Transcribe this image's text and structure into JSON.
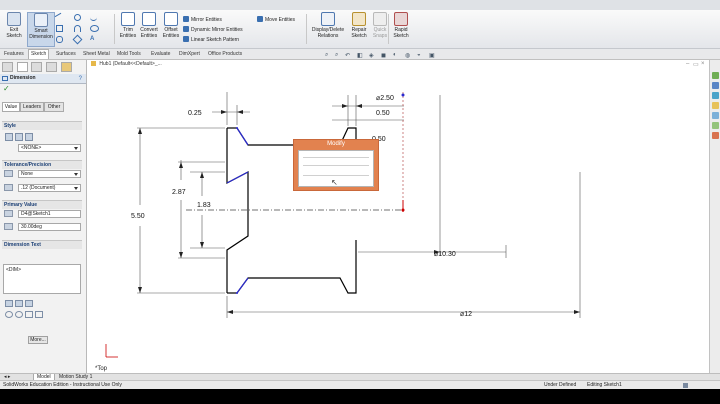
{
  "ribbon": {
    "exit_sketch": "Exit Sketch",
    "smart_dimension": "Smart Dimension",
    "trim_entities": "Trim Entities",
    "convert_entities": "Convert Entities",
    "offset_entities": "Offset Entities",
    "mirror_entities": "Mirror Entities",
    "dynamic_mirror_entities": "Dynamic Mirror Entities",
    "linear_sketch_pattern": "Linear Sketch Pattern",
    "move_entities": "Move Entities",
    "display_delete_relations": "Display/Delete Relations",
    "repair_sketch": "Repair Sketch",
    "quick_snaps": "Quick Snaps",
    "rapid_sketch": "Rapid Sketch"
  },
  "command_tabs": [
    "Features",
    "Sketch",
    "Surfaces",
    "Sheet Metal",
    "Mold Tools",
    "Evaluate",
    "DimXpert",
    "Office Products"
  ],
  "active_command_tab": "Sketch",
  "feature_tree": {
    "breadcrumb": "Hub1 (Default<<Default>_..."
  },
  "property_manager": {
    "title": "Dimension",
    "subtabs": [
      "Value",
      "Leaders",
      "Other"
    ],
    "style_label": "Style",
    "style_value": "<NONE>",
    "tolerance_label": "Tolerance/Precision",
    "tolerance_value": "None",
    "precision_value": ".12 (Document)",
    "primary_value_label": "Primary Value",
    "primary_value_name": "D4@Sketch1",
    "primary_value_value": "30.00deg",
    "dimension_text_label": "Dimension Text",
    "dimension_text_value": "<DIM>",
    "more_button": "More..."
  },
  "drawing": {
    "dims": {
      "d025": "0.25",
      "d250": "⌀2.50",
      "d050a": "0.50",
      "d050b": "0.50",
      "d287": "2.87",
      "d183": "1.83",
      "d550": "5.50",
      "d1030": "⌀10.30",
      "d12": "⌀12"
    },
    "view_label": "*Top"
  },
  "modify_dialog": {
    "title": "Modify"
  },
  "model_tabs": [
    "Model",
    "Motion Study 1"
  ],
  "status_bar": {
    "left": "SolidWorks Education Edition - Instructional Use Only",
    "state": "Under Defined",
    "editing": "Editing Sketch1"
  },
  "colors": {
    "sketch_line": "#000000",
    "dimension": "#1a1a1a",
    "modify_header": "#e2824f",
    "endpoint": "#2a2ad0",
    "origin": "#cc0000"
  }
}
